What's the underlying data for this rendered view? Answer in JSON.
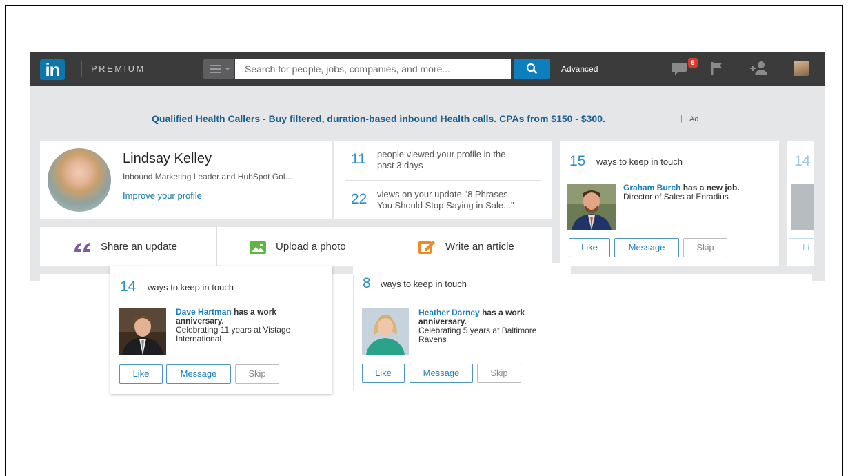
{
  "topbar": {
    "logo_text": "in",
    "premium_label": "PREMIUM",
    "search_placeholder": "Search for people, jobs, companies, and more...",
    "advanced_label": "Advanced",
    "messages_badge": "5",
    "icons": [
      "menu-icon",
      "search-icon",
      "messages-icon",
      "flag-icon",
      "add-connection-icon"
    ]
  },
  "ad": {
    "link_text": "Qualified Health Callers - Buy filtered, duration-based inbound Health calls. CPAs from $150 - $300.",
    "separator": "|",
    "label": "Ad"
  },
  "profile": {
    "name": "Lindsay Kelley",
    "headline": "Inbound Marketing Leader and HubSpot Gol...",
    "improve_link": "Improve your profile"
  },
  "stats": [
    {
      "number": "11",
      "text_line1": "people viewed your profile in the",
      "text_line2": "past 3 days"
    },
    {
      "number": "22",
      "text_line1": "views on your update \"8 Phrases",
      "text_line2": "You Should Stop Saying in Sale...\""
    }
  ],
  "actions": [
    {
      "label": "Share an update",
      "icon": "quote-icon"
    },
    {
      "label": "Upload a photo",
      "icon": "photo-icon"
    },
    {
      "label": "Write an article",
      "icon": "pencil-icon"
    }
  ],
  "keep_in_touch": {
    "title": "ways to keep in touch",
    "main": {
      "count": "15",
      "person": "Graham Burch",
      "event": "has a new job.",
      "detail": "Director of Sales at Enradius"
    },
    "peek_count": "14",
    "peek_button": "Li",
    "left_popup": {
      "count": "14",
      "person": "Dave Hartman",
      "event": "has a work anniversary.",
      "event_line1": "has a work",
      "event_line2": "anniversary.",
      "detail_line1": "Celebrating 11 years at Vistage",
      "detail_line2": "International"
    },
    "right_popup": {
      "count": "8",
      "person": "Heather Darney",
      "event_line1": "has a work",
      "event_line2": "anniversary.",
      "detail_line1": "Celebrating 5 years at Baltimore",
      "detail_line2": "Ravens"
    },
    "buttons": {
      "like": "Like",
      "message": "Message",
      "skip": "Skip"
    }
  },
  "colors": {
    "topbar_bg": "#3b3b3c",
    "brand_blue": "#0e76a8",
    "link_blue": "#1a7dc2",
    "content_bg": "#e4e6e8",
    "badge_red": "#d93a2b"
  }
}
